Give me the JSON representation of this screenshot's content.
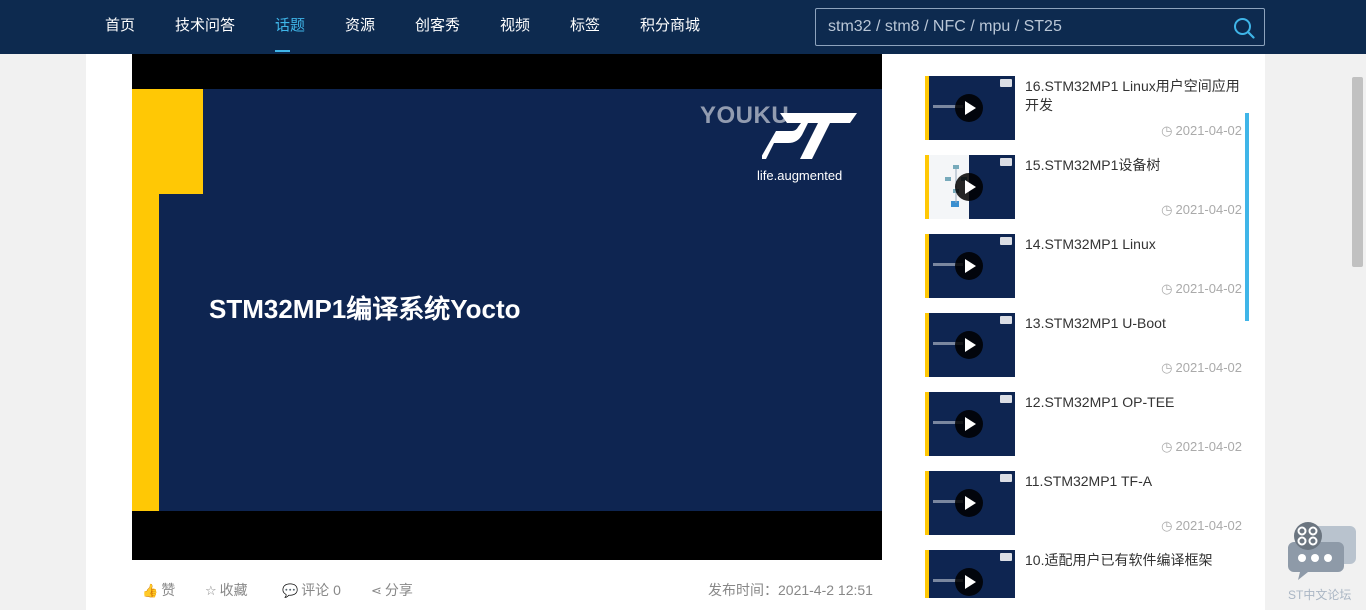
{
  "nav": {
    "items": [
      {
        "label": "首页",
        "active": false
      },
      {
        "label": "技术问答",
        "active": false
      },
      {
        "label": "话题",
        "active": true
      },
      {
        "label": "资源",
        "active": false
      },
      {
        "label": "创客秀",
        "active": false
      },
      {
        "label": "视频",
        "active": false
      },
      {
        "label": "标签",
        "active": false
      },
      {
        "label": "积分商城",
        "active": false
      }
    ],
    "search_placeholder": "stm32 / stm8 / NFC / mpu / ST25",
    "search_icon": "search-icon"
  },
  "video": {
    "watermark": "YOUKU",
    "logo_tagline": "life.augmented",
    "slide_title": "STM32MP1编译系统Yocto"
  },
  "actions": {
    "like": "赞",
    "favorite": "收藏",
    "comment": "评论 0",
    "share": "分享",
    "publish_time": "发布时间：2021-4-2 12:51"
  },
  "related": [
    {
      "title": "16.STM32MP1 Linux用户空间应用开发",
      "date": "2021-04-02"
    },
    {
      "title": "15.STM32MP1设备树",
      "date": "2021-04-02"
    },
    {
      "title": "14.STM32MP1 Linux",
      "date": "2021-04-02"
    },
    {
      "title": "13.STM32MP1 U-Boot",
      "date": "2021-04-02"
    },
    {
      "title": "12.STM32MP1 OP-TEE",
      "date": "2021-04-02"
    },
    {
      "title": "11.STM32MP1 TF-A",
      "date": "2021-04-02"
    },
    {
      "title": "10.适配用户已有软件编译框架",
      "date": ""
    }
  ],
  "float_widget": {
    "label": "ST中文论坛"
  },
  "colors": {
    "nav_bg": "#0d2a4f",
    "accent": "#3fb5e8",
    "slide_bg": "#0e2551",
    "st_yellow": "#ffc805"
  }
}
